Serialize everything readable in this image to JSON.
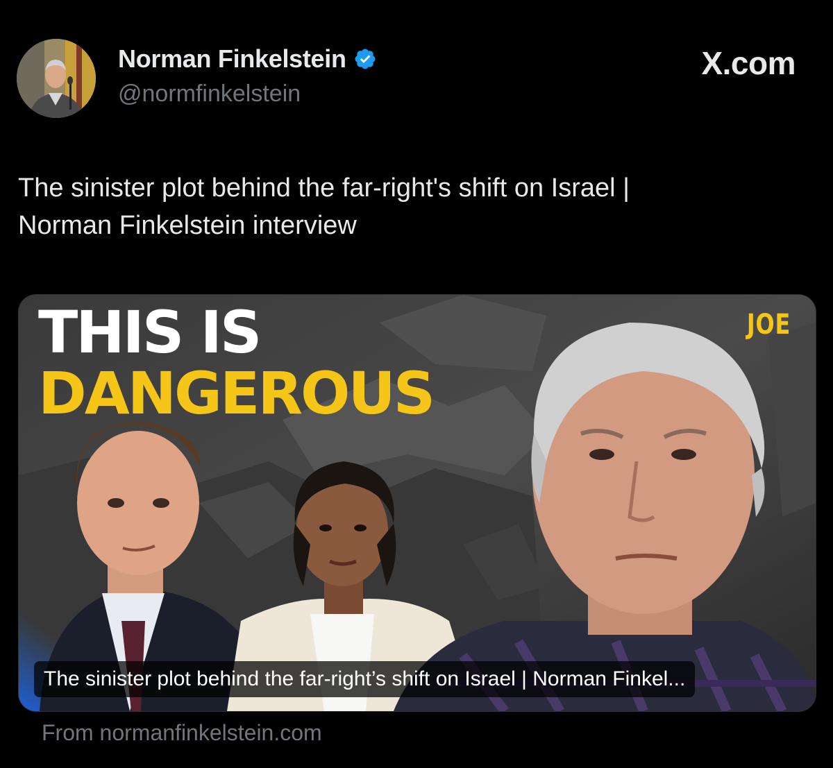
{
  "author": {
    "display_name": "Norman Finkelstein",
    "handle": "@normfinkelstein",
    "verified": true,
    "avatar_icon": "profile-photo"
  },
  "brand": "X.com",
  "tweet": {
    "text_line1": "The sinister plot behind the far-right's shift on Israel |",
    "text_line2": "Norman Finkelstein interview"
  },
  "media": {
    "headline_line1": "THIS IS",
    "headline_line2": "DANGEROUS",
    "channel_logo": "JOE",
    "caption": "The sinister plot behind the far-right’s shift on Israel | Norman Finkel..."
  },
  "link_source": "From normanfinkelstein.com",
  "colors": {
    "background": "#000000",
    "primary_text": "#e7e9ea",
    "secondary_text": "#71767b",
    "verified_blue": "#1d9bf0",
    "headline_yellow": "#f5c518"
  }
}
